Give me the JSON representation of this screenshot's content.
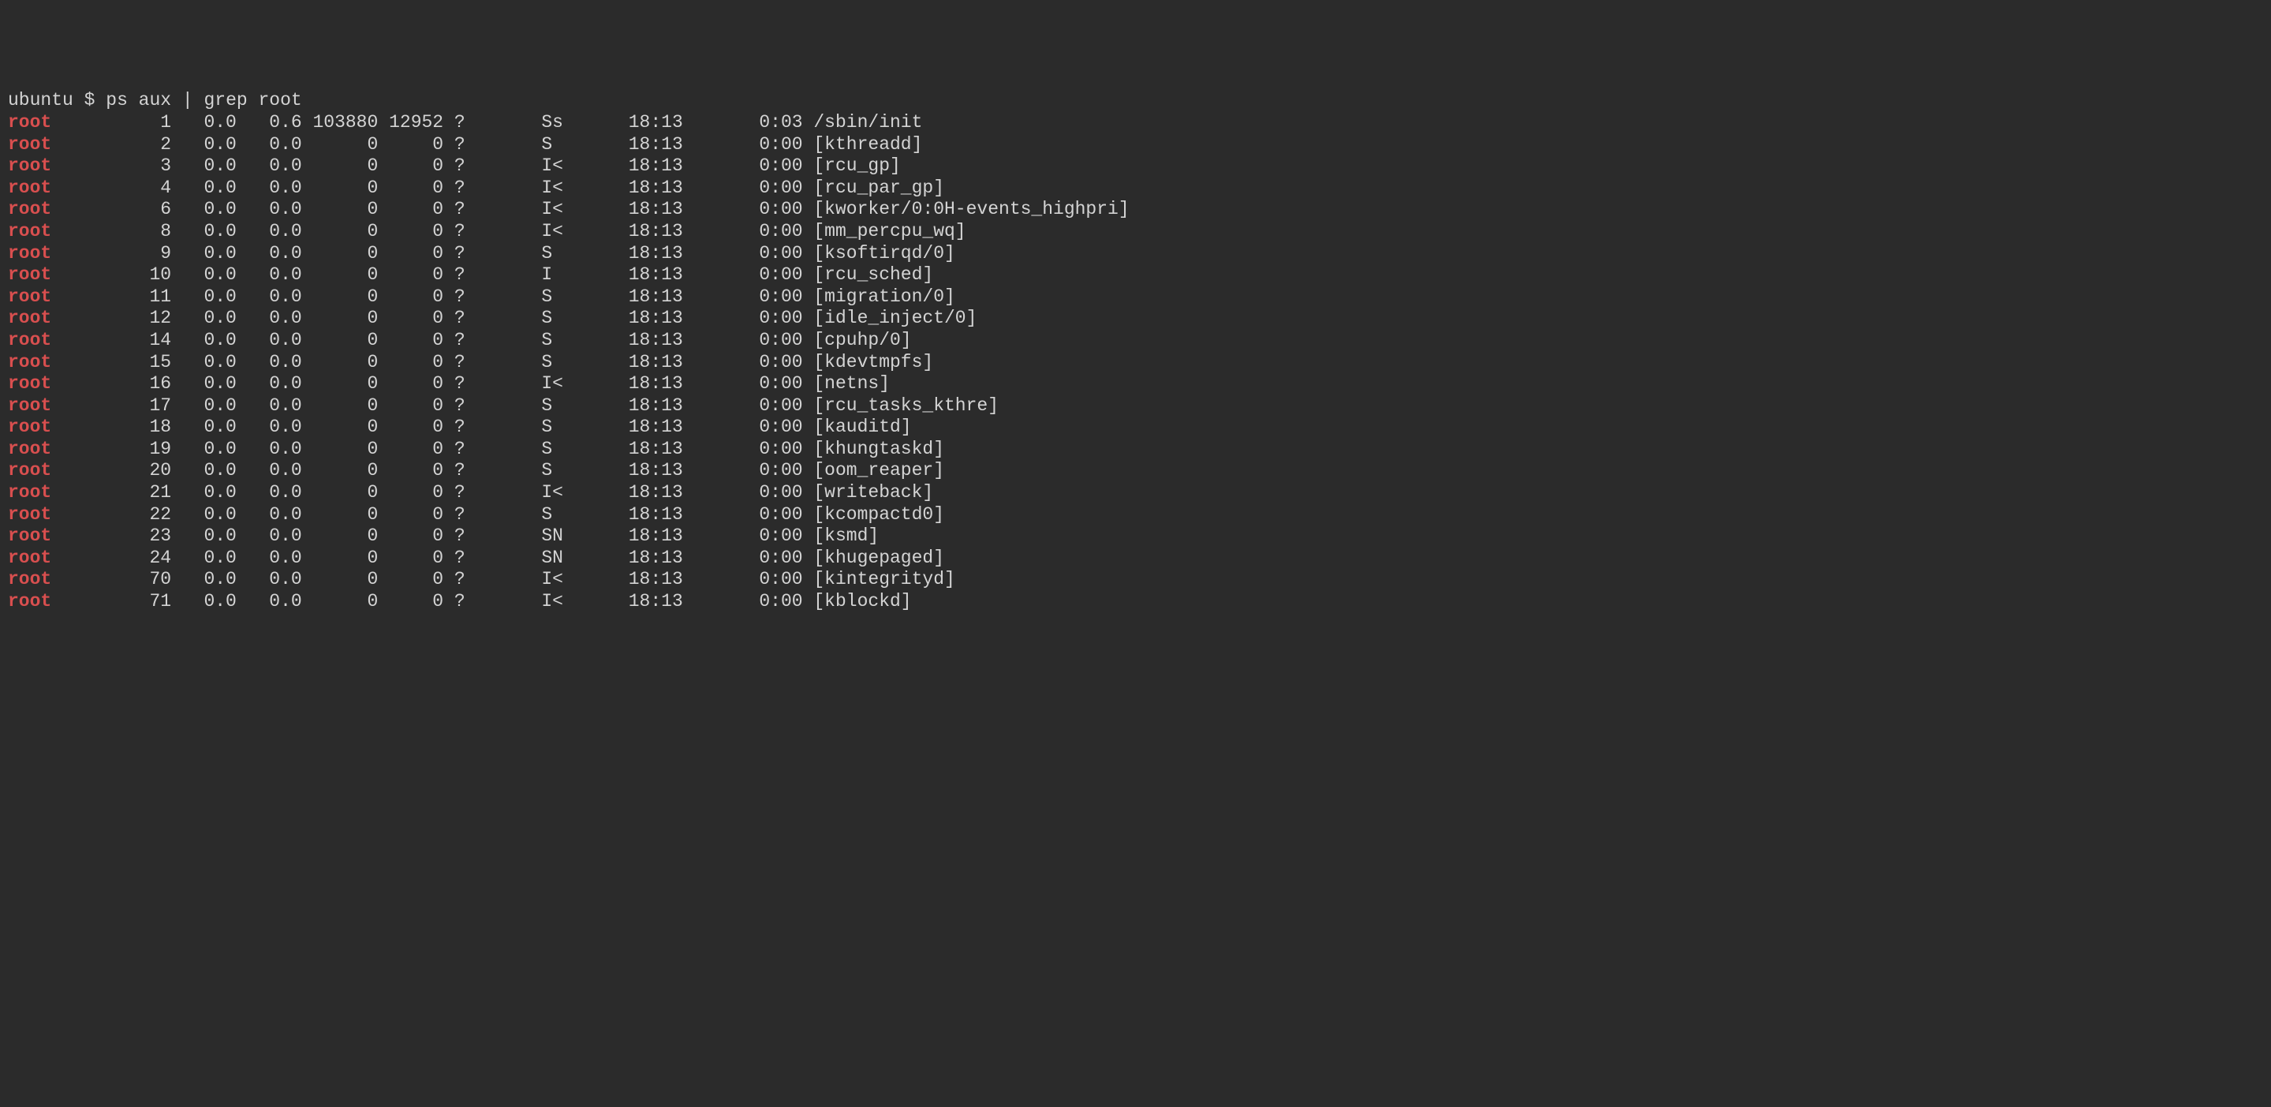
{
  "prompt": {
    "user": "ubuntu",
    "symbol": "$",
    "command": "ps aux | grep root"
  },
  "match_word": "root",
  "columns": {
    "user_width": 4,
    "pid_width": 11,
    "cpu_width": 6,
    "mem_width": 6,
    "vsz_width": 7,
    "rss_width": 6,
    "tty_width": 8,
    "stat_width": 8,
    "start_width": 7,
    "time_width": 9
  },
  "rows": [
    {
      "user": "root",
      "pid": "1",
      "cpu": "0.0",
      "mem": "0.6",
      "vsz": "103880",
      "rss": "12952",
      "tty": "?",
      "stat": "Ss",
      "start": "18:13",
      "time": "0:03",
      "command": "/sbin/init"
    },
    {
      "user": "root",
      "pid": "2",
      "cpu": "0.0",
      "mem": "0.0",
      "vsz": "0",
      "rss": "0",
      "tty": "?",
      "stat": "S",
      "start": "18:13",
      "time": "0:00",
      "command": "[kthreadd]"
    },
    {
      "user": "root",
      "pid": "3",
      "cpu": "0.0",
      "mem": "0.0",
      "vsz": "0",
      "rss": "0",
      "tty": "?",
      "stat": "I<",
      "start": "18:13",
      "time": "0:00",
      "command": "[rcu_gp]"
    },
    {
      "user": "root",
      "pid": "4",
      "cpu": "0.0",
      "mem": "0.0",
      "vsz": "0",
      "rss": "0",
      "tty": "?",
      "stat": "I<",
      "start": "18:13",
      "time": "0:00",
      "command": "[rcu_par_gp]"
    },
    {
      "user": "root",
      "pid": "6",
      "cpu": "0.0",
      "mem": "0.0",
      "vsz": "0",
      "rss": "0",
      "tty": "?",
      "stat": "I<",
      "start": "18:13",
      "time": "0:00",
      "command": "[kworker/0:0H-events_highpri]"
    },
    {
      "user": "root",
      "pid": "8",
      "cpu": "0.0",
      "mem": "0.0",
      "vsz": "0",
      "rss": "0",
      "tty": "?",
      "stat": "I<",
      "start": "18:13",
      "time": "0:00",
      "command": "[mm_percpu_wq]"
    },
    {
      "user": "root",
      "pid": "9",
      "cpu": "0.0",
      "mem": "0.0",
      "vsz": "0",
      "rss": "0",
      "tty": "?",
      "stat": "S",
      "start": "18:13",
      "time": "0:00",
      "command": "[ksoftirqd/0]"
    },
    {
      "user": "root",
      "pid": "10",
      "cpu": "0.0",
      "mem": "0.0",
      "vsz": "0",
      "rss": "0",
      "tty": "?",
      "stat": "I",
      "start": "18:13",
      "time": "0:00",
      "command": "[rcu_sched]"
    },
    {
      "user": "root",
      "pid": "11",
      "cpu": "0.0",
      "mem": "0.0",
      "vsz": "0",
      "rss": "0",
      "tty": "?",
      "stat": "S",
      "start": "18:13",
      "time": "0:00",
      "command": "[migration/0]"
    },
    {
      "user": "root",
      "pid": "12",
      "cpu": "0.0",
      "mem": "0.0",
      "vsz": "0",
      "rss": "0",
      "tty": "?",
      "stat": "S",
      "start": "18:13",
      "time": "0:00",
      "command": "[idle_inject/0]"
    },
    {
      "user": "root",
      "pid": "14",
      "cpu": "0.0",
      "mem": "0.0",
      "vsz": "0",
      "rss": "0",
      "tty": "?",
      "stat": "S",
      "start": "18:13",
      "time": "0:00",
      "command": "[cpuhp/0]"
    },
    {
      "user": "root",
      "pid": "15",
      "cpu": "0.0",
      "mem": "0.0",
      "vsz": "0",
      "rss": "0",
      "tty": "?",
      "stat": "S",
      "start": "18:13",
      "time": "0:00",
      "command": "[kdevtmpfs]"
    },
    {
      "user": "root",
      "pid": "16",
      "cpu": "0.0",
      "mem": "0.0",
      "vsz": "0",
      "rss": "0",
      "tty": "?",
      "stat": "I<",
      "start": "18:13",
      "time": "0:00",
      "command": "[netns]"
    },
    {
      "user": "root",
      "pid": "17",
      "cpu": "0.0",
      "mem": "0.0",
      "vsz": "0",
      "rss": "0",
      "tty": "?",
      "stat": "S",
      "start": "18:13",
      "time": "0:00",
      "command": "[rcu_tasks_kthre]"
    },
    {
      "user": "root",
      "pid": "18",
      "cpu": "0.0",
      "mem": "0.0",
      "vsz": "0",
      "rss": "0",
      "tty": "?",
      "stat": "S",
      "start": "18:13",
      "time": "0:00",
      "command": "[kauditd]"
    },
    {
      "user": "root",
      "pid": "19",
      "cpu": "0.0",
      "mem": "0.0",
      "vsz": "0",
      "rss": "0",
      "tty": "?",
      "stat": "S",
      "start": "18:13",
      "time": "0:00",
      "command": "[khungtaskd]"
    },
    {
      "user": "root",
      "pid": "20",
      "cpu": "0.0",
      "mem": "0.0",
      "vsz": "0",
      "rss": "0",
      "tty": "?",
      "stat": "S",
      "start": "18:13",
      "time": "0:00",
      "command": "[oom_reaper]"
    },
    {
      "user": "root",
      "pid": "21",
      "cpu": "0.0",
      "mem": "0.0",
      "vsz": "0",
      "rss": "0",
      "tty": "?",
      "stat": "I<",
      "start": "18:13",
      "time": "0:00",
      "command": "[writeback]"
    },
    {
      "user": "root",
      "pid": "22",
      "cpu": "0.0",
      "mem": "0.0",
      "vsz": "0",
      "rss": "0",
      "tty": "?",
      "stat": "S",
      "start": "18:13",
      "time": "0:00",
      "command": "[kcompactd0]"
    },
    {
      "user": "root",
      "pid": "23",
      "cpu": "0.0",
      "mem": "0.0",
      "vsz": "0",
      "rss": "0",
      "tty": "?",
      "stat": "SN",
      "start": "18:13",
      "time": "0:00",
      "command": "[ksmd]"
    },
    {
      "user": "root",
      "pid": "24",
      "cpu": "0.0",
      "mem": "0.0",
      "vsz": "0",
      "rss": "0",
      "tty": "?",
      "stat": "SN",
      "start": "18:13",
      "time": "0:00",
      "command": "[khugepaged]"
    },
    {
      "user": "root",
      "pid": "70",
      "cpu": "0.0",
      "mem": "0.0",
      "vsz": "0",
      "rss": "0",
      "tty": "?",
      "stat": "I<",
      "start": "18:13",
      "time": "0:00",
      "command": "[kintegrityd]"
    },
    {
      "user": "root",
      "pid": "71",
      "cpu": "0.0",
      "mem": "0.0",
      "vsz": "0",
      "rss": "0",
      "tty": "?",
      "stat": "I<",
      "start": "18:13",
      "time": "0:00",
      "command": "[kblockd]"
    }
  ]
}
